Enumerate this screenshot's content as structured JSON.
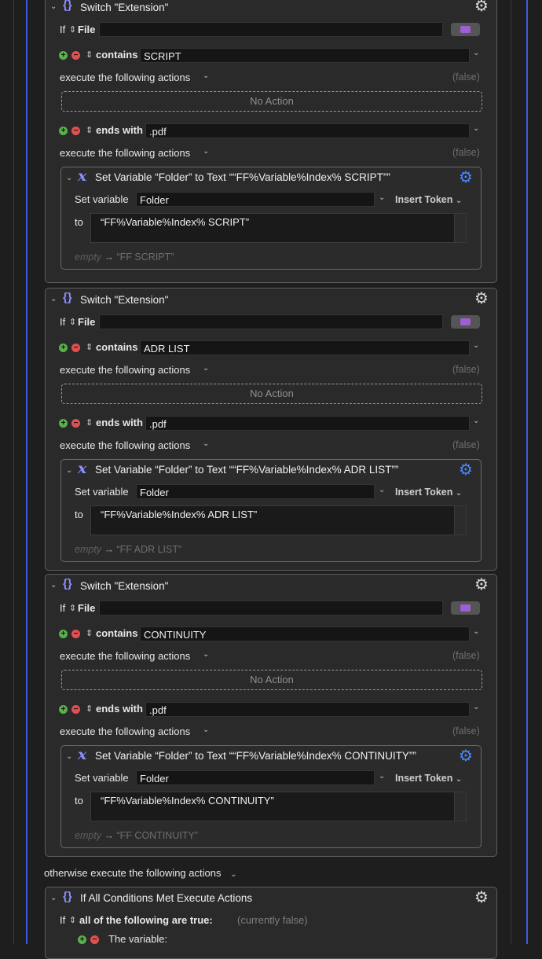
{
  "switch_blocks": [
    {
      "title": "Switch \"Extension\"",
      "if_label": "If",
      "source": "File",
      "case1": {
        "operator": "contains",
        "value": "SCRIPT",
        "exec": "execute the following actions",
        "status": "(false)",
        "no_action": "No Action"
      },
      "case2": {
        "operator": "ends with",
        "value": ".pdf",
        "exec": "execute the following actions",
        "status": "(false)"
      },
      "action": {
        "title": "Set Variable “Folder” to Text ““FF%Variable%Index% SCRIPT””",
        "set_label": "Set variable",
        "variable": "Folder",
        "insert_token": "Insert Token",
        "to_label": "to",
        "text": "“FF%Variable%Index% SCRIPT”",
        "empty_label": "empty",
        "result": "“FF SCRIPT”"
      }
    },
    {
      "title": "Switch \"Extension\"",
      "if_label": "If",
      "source": "File",
      "case1": {
        "operator": "contains",
        "value": "ADR LIST",
        "exec": "execute the following actions",
        "status": "(false)",
        "no_action": "No Action"
      },
      "case2": {
        "operator": "ends with",
        "value": ".pdf",
        "exec": "execute the following actions",
        "status": "(false)"
      },
      "action": {
        "title": "Set Variable “Folder” to Text ““FF%Variable%Index% ADR LIST””",
        "set_label": "Set variable",
        "variable": "Folder",
        "insert_token": "Insert Token",
        "to_label": "to",
        "text": "“FF%Variable%Index% ADR LIST”",
        "empty_label": "empty",
        "result": "“FF ADR LIST”"
      }
    },
    {
      "title": "Switch \"Extension\"",
      "if_label": "If",
      "source": "File",
      "case1": {
        "operator": "contains",
        "value": "CONTINUITY",
        "exec": "execute the following actions",
        "status": "(false)",
        "no_action": "No Action"
      },
      "case2": {
        "operator": "ends with",
        "value": ".pdf",
        "exec": "execute the following actions",
        "status": "(false)"
      },
      "action": {
        "title": "Set Variable “Folder” to Text ““FF%Variable%Index% CONTINUITY””",
        "set_label": "Set variable",
        "variable": "Folder",
        "insert_token": "Insert Token",
        "to_label": "to",
        "text": "“FF%Variable%Index% CONTINUITY”",
        "empty_label": "empty",
        "result": "“FF CONTINUITY”"
      }
    }
  ],
  "otherwise": "otherwise execute the following actions",
  "if_block": {
    "title": "If All Conditions Met Execute Actions",
    "if_label": "If",
    "condition": "all of the following are true:",
    "status": "(currently false)",
    "first_condition": "The variable:"
  },
  "colors": {
    "accent_blue": "#3d5be0",
    "braces": "#8c8fff",
    "gear_active": "#4a86ff"
  }
}
